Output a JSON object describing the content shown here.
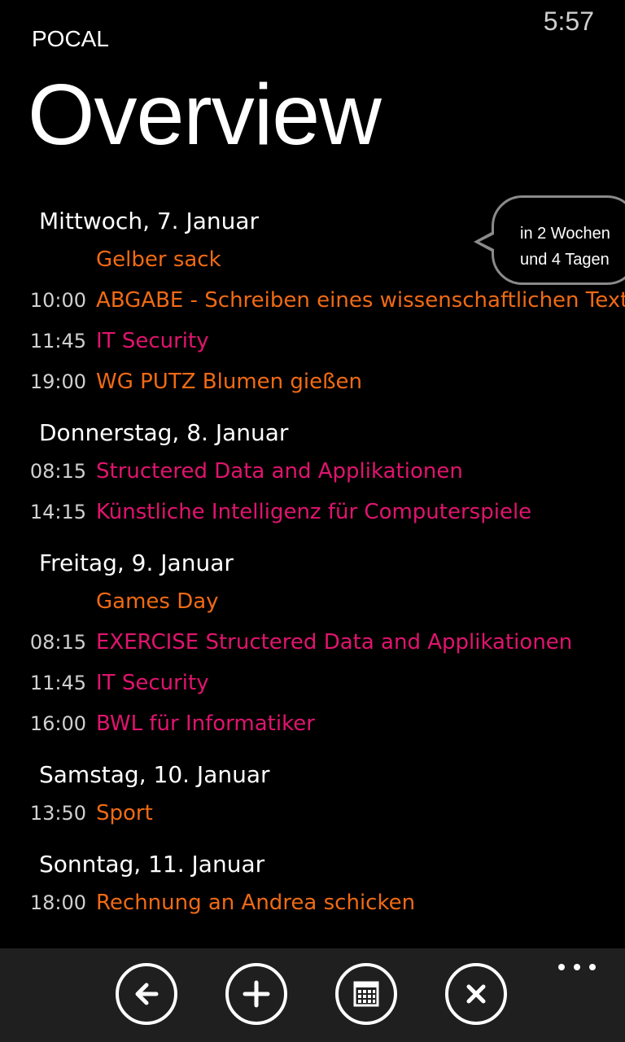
{
  "status_bar": {
    "time": "5:57"
  },
  "header": {
    "app_name": "POCAL",
    "title": "Overview"
  },
  "colors": {
    "orange": "#f06a14",
    "magenta": "#e0146e"
  },
  "bubble": {
    "line1": "in 2 Wochen",
    "line2": "und 4 Tagen"
  },
  "days": [
    {
      "header": "Mittwoch, 7. Januar",
      "events": [
        {
          "time": "",
          "title": "Gelber sack",
          "color": "#f06a14"
        },
        {
          "time": "10:00",
          "title": "ABGABE - Schreiben eines wissenschaftlichen Texte",
          "color": "#f06a14"
        },
        {
          "time": "11:45",
          "title": "IT Security",
          "color": "#e0146e"
        },
        {
          "time": "19:00",
          "title": "WG PUTZ Blumen gießen",
          "color": "#f06a14"
        }
      ]
    },
    {
      "header": "Donnerstag, 8. Januar",
      "events": [
        {
          "time": "08:15",
          "title": "Structered Data and Applikationen",
          "color": "#e0146e"
        },
        {
          "time": "14:15",
          "title": "Künstliche Intelligenz für Computerspiele",
          "color": "#e0146e"
        }
      ]
    },
    {
      "header": "Freitag, 9. Januar",
      "events": [
        {
          "time": "",
          "title": "Games Day",
          "color": "#f06a14"
        },
        {
          "time": "08:15",
          "title": "EXERCISE Structered Data and Applikationen",
          "color": "#e0146e"
        },
        {
          "time": "11:45",
          "title": "IT Security",
          "color": "#e0146e"
        },
        {
          "time": "16:00",
          "title": "BWL für Informatiker",
          "color": "#e0146e"
        }
      ]
    },
    {
      "header": "Samstag, 10. Januar",
      "events": [
        {
          "time": "13:50",
          "title": "Sport",
          "color": "#f06a14"
        }
      ]
    },
    {
      "header": "Sonntag, 11. Januar",
      "events": [
        {
          "time": "18:00",
          "title": "Rechnung an Andrea schicken",
          "color": "#f06a14"
        }
      ]
    }
  ],
  "app_bar": {
    "buttons": [
      {
        "name": "back-button",
        "icon": "arrow-left-icon"
      },
      {
        "name": "add-button",
        "icon": "plus-icon"
      },
      {
        "name": "calendar-button",
        "icon": "calendar-icon"
      },
      {
        "name": "close-button",
        "icon": "close-icon"
      }
    ],
    "more_icon": "ellipsis-icon"
  }
}
